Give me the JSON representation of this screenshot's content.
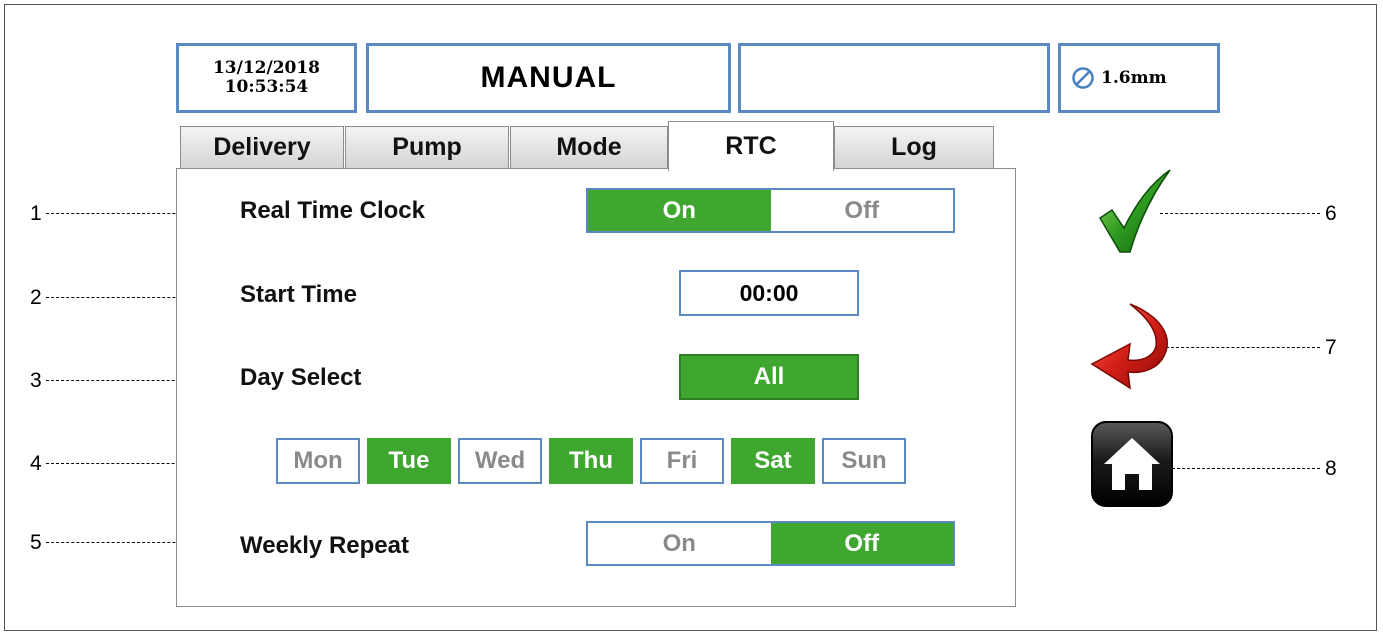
{
  "header": {
    "date": "13/12/2018",
    "time": "10:53:54",
    "mode": "MANUAL",
    "status": "",
    "wire_size": "1.6mm"
  },
  "tabs": [
    {
      "label": "Delivery",
      "active": false
    },
    {
      "label": "Pump",
      "active": false
    },
    {
      "label": "Mode",
      "active": false
    },
    {
      "label": "RTC",
      "active": true
    },
    {
      "label": "Log",
      "active": false
    }
  ],
  "rtc": {
    "real_time_clock": {
      "label": "Real Time Clock",
      "on": "On",
      "off": "Off",
      "selected": "On"
    },
    "start_time": {
      "label": "Start Time",
      "value": "00:00"
    },
    "day_select": {
      "label": "Day Select",
      "button": "All"
    },
    "days": [
      {
        "label": "Mon",
        "selected": false
      },
      {
        "label": "Tue",
        "selected": true
      },
      {
        "label": "Wed",
        "selected": false
      },
      {
        "label": "Thu",
        "selected": true
      },
      {
        "label": "Fri",
        "selected": false
      },
      {
        "label": "Sat",
        "selected": true
      },
      {
        "label": "Sun",
        "selected": false
      }
    ],
    "weekly_repeat": {
      "label": "Weekly Repeat",
      "on": "On",
      "off": "Off",
      "selected": "Off"
    }
  },
  "side_buttons": [
    {
      "icon": "checkmark-icon",
      "action": "confirm"
    },
    {
      "icon": "back-arrow-icon",
      "action": "back"
    },
    {
      "icon": "home-icon",
      "action": "home"
    }
  ],
  "callouts": [
    "1",
    "2",
    "3",
    "4",
    "5",
    "6",
    "7",
    "8"
  ],
  "colors": {
    "accent_green": "#3fa630",
    "border_blue": "#5b8ac2"
  }
}
